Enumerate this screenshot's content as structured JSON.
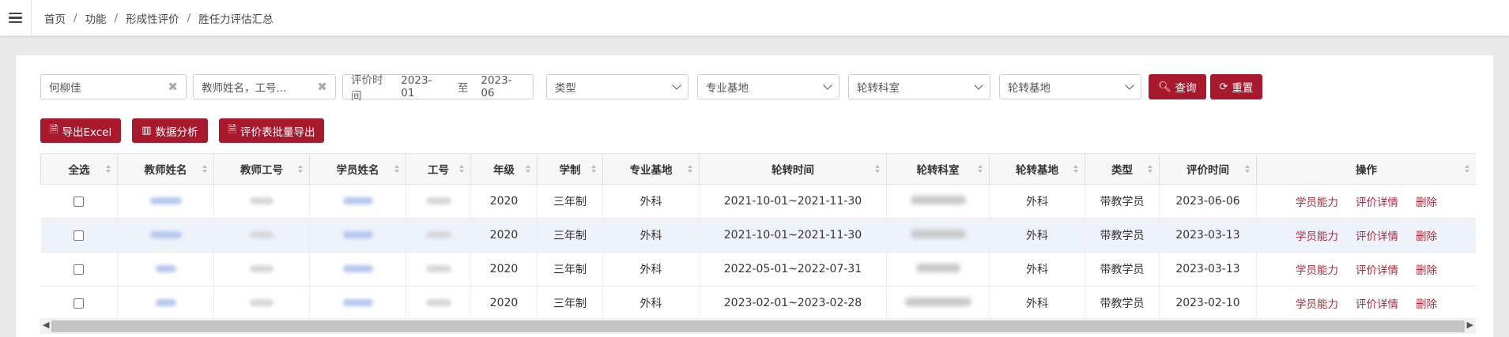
{
  "breadcrumb": [
    "首页",
    "功能",
    "形成性评价",
    "胜任力评估汇总"
  ],
  "filters": {
    "student_name": "何柳佳",
    "teacher_placeholder": "教师姓名，工号...",
    "range_label": "评价时间",
    "range_start": "2023-01",
    "range_mid": "至",
    "range_end": "2023-06",
    "type_placeholder": "类型",
    "base_placeholder": "专业基地",
    "dept_placeholder": "轮转科室",
    "rotation_base_placeholder": "轮转基地",
    "query_label": "查询",
    "reset_label": "重置"
  },
  "actions": {
    "export_excel": "导出Excel",
    "data_analysis": "数据分析",
    "batch_export": "评价表批量导出"
  },
  "table": {
    "headers": [
      "全选",
      "教师姓名",
      "教师工号",
      "学员姓名",
      "工号",
      "年级",
      "学制",
      "专业基地",
      "轮转时间",
      "轮转科室",
      "轮转基地",
      "类型",
      "评价时间",
      "操作"
    ],
    "rows": [
      {
        "grade": "2020",
        "system": "三年制",
        "base": "外科",
        "period": "2021-10-01~2021-11-30",
        "rotation_base": "外科",
        "type": "带教学员",
        "eval_date": "2023-06-06"
      },
      {
        "grade": "2020",
        "system": "三年制",
        "base": "外科",
        "period": "2021-10-01~2021-11-30",
        "rotation_base": "外科",
        "type": "带教学员",
        "eval_date": "2023-03-13"
      },
      {
        "grade": "2020",
        "system": "三年制",
        "base": "外科",
        "period": "2022-05-01~2022-07-31",
        "rotation_base": "外科",
        "type": "带教学员",
        "eval_date": "2023-03-13"
      },
      {
        "grade": "2020",
        "system": "三年制",
        "base": "外科",
        "period": "2023-02-01~2023-02-28",
        "rotation_base": "外科",
        "type": "带教学员",
        "eval_date": "2023-02-10"
      }
    ],
    "ops": {
      "ability": "学员能力",
      "detail": "评价详情",
      "delete": "删除"
    }
  },
  "colors": {
    "accent": "#a8192e",
    "link": "#b0283a",
    "highlight_row": "#eef3fb"
  }
}
